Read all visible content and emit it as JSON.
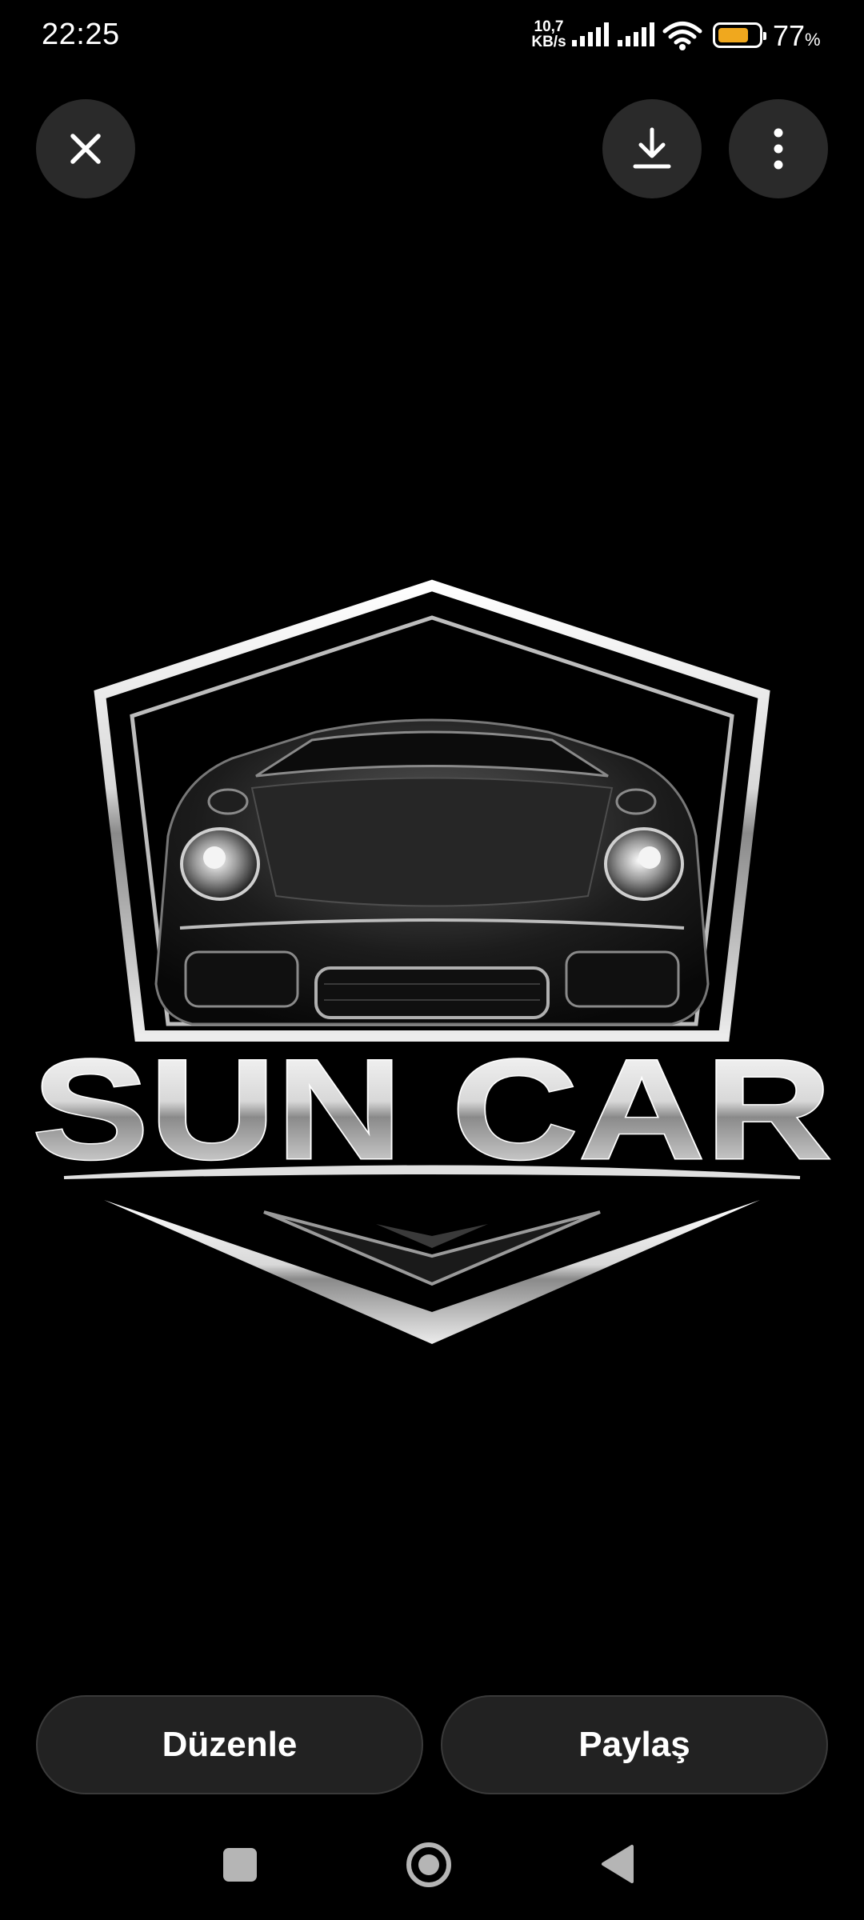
{
  "status_bar": {
    "time": "22:25",
    "net_speed_value": "10,7",
    "net_speed_unit": "KB/s",
    "battery_percent": "77",
    "battery_percent_sign": "%",
    "battery_level": 0.77,
    "icons": [
      "cellular-signal-icon",
      "cellular-signal-icon",
      "wifi-icon",
      "battery-icon"
    ]
  },
  "top_actions": {
    "close_icon": "close-icon",
    "download_icon": "download-icon",
    "more_icon": "more-vertical-icon"
  },
  "image": {
    "brand_text": "SUN CAR"
  },
  "bottom_actions": {
    "edit_label": "Düzenle",
    "share_label": "Paylaş"
  },
  "nav_bar": {
    "icons": [
      "recents-icon",
      "home-icon",
      "back-icon"
    ]
  },
  "colors": {
    "background": "#000000",
    "button_bg": "#2a2a2a",
    "battery_fill": "#f0a81e",
    "nav_icon": "#b5b5b5"
  }
}
